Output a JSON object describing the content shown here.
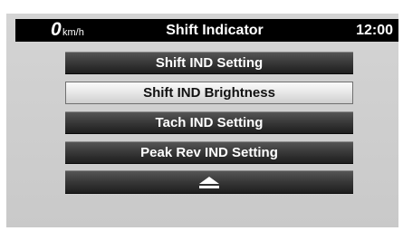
{
  "status_bar": {
    "speed_value": "0",
    "speed_unit": "km/h",
    "title": "Shift Indicator",
    "clock": "12:00"
  },
  "menu": {
    "items": [
      {
        "label": "Shift IND Setting",
        "selected": false
      },
      {
        "label": "Shift IND Brightness",
        "selected": true
      },
      {
        "label": "Tach IND Setting",
        "selected": false
      },
      {
        "label": "Peak Rev IND Setting",
        "selected": false
      }
    ],
    "scroll_up_icon": "eject-icon"
  },
  "colors": {
    "screen_background": "#cccccc",
    "status_bar": "#000000",
    "button_dark": "#2e2e2e",
    "button_selected": "#e6e6e6"
  }
}
